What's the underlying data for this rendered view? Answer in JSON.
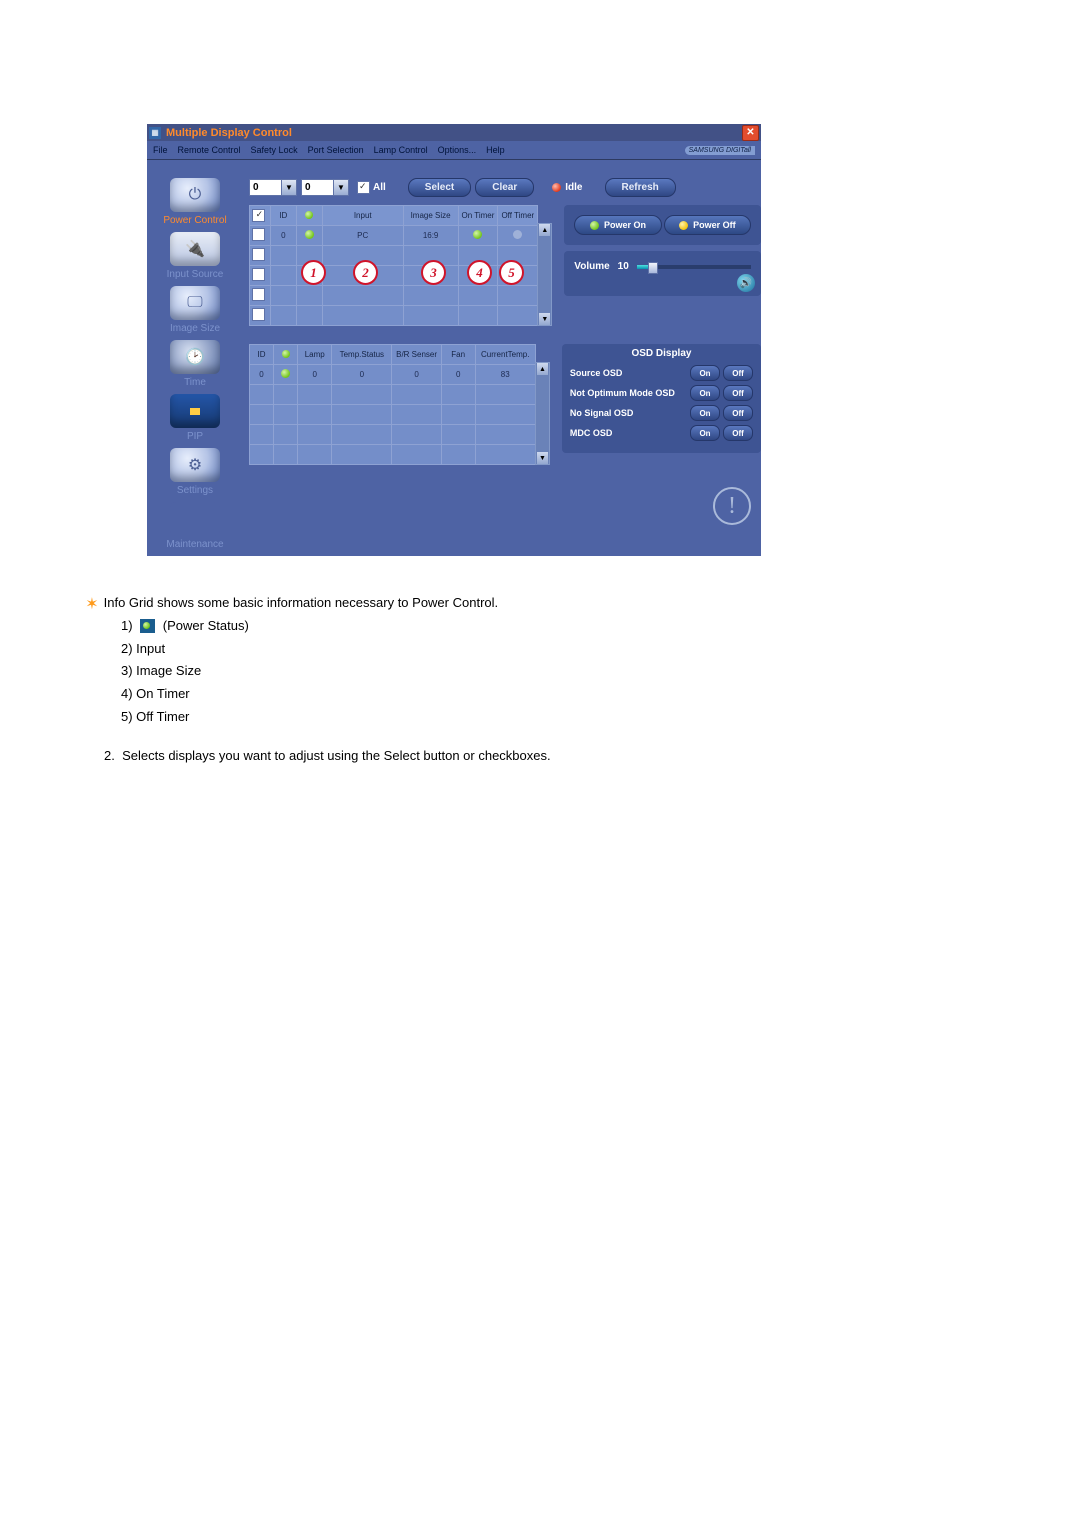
{
  "window": {
    "title": "Multiple Display Control",
    "brand": "SAMSUNG DIGITall"
  },
  "menu": {
    "items": [
      "File",
      "Remote Control",
      "Safety Lock",
      "Port Selection",
      "Lamp Control",
      "Options...",
      "Help"
    ]
  },
  "sidebar": {
    "items": [
      {
        "label": "Power Control",
        "active": true
      },
      {
        "label": "Input Source"
      },
      {
        "label": "Image Size"
      },
      {
        "label": "Time"
      },
      {
        "label": "PIP"
      },
      {
        "label": "Settings"
      },
      {
        "label": "Maintenance"
      }
    ]
  },
  "toolbar": {
    "spin1": "0",
    "spin2": "0",
    "all_checked": true,
    "all_label": "All",
    "select_label": "Select",
    "clear_label": "Clear",
    "idle_label": "Idle",
    "refresh_label": "Refresh"
  },
  "grid_top": {
    "headers": [
      "",
      "ID",
      "",
      "Input",
      "Image Size",
      "On Timer",
      "Off Timer"
    ],
    "row": {
      "checked": false,
      "id": "0",
      "power": "green",
      "input": "PC",
      "size": "16:9",
      "on": "green",
      "off": "grey"
    },
    "blank_rows": 4
  },
  "annotations": [
    "1",
    "2",
    "3",
    "4",
    "5"
  ],
  "power": {
    "on": "Power On",
    "off": "Power Off"
  },
  "volume": {
    "label": "Volume",
    "value": "10"
  },
  "grid_bottom": {
    "headers": [
      "ID",
      "",
      "Lamp",
      "Temp.Status",
      "B/R Senser",
      "Fan",
      "CurrentTemp."
    ],
    "row": {
      "id": "0",
      "pw": "green",
      "lamp": "0",
      "ts": "0",
      "brs": "0",
      "fan": "0",
      "ct": "83"
    },
    "blank_rows": 4
  },
  "osd": {
    "title": "OSD Display",
    "rows": [
      {
        "label": "Source OSD"
      },
      {
        "label": "Not Optimum Mode OSD"
      },
      {
        "label": "No Signal OSD"
      },
      {
        "label": "MDC OSD"
      }
    ],
    "on": "On",
    "off": "Off"
  },
  "docs": {
    "intro": "Info Grid shows some basic information necessary to Power Control.",
    "list": [
      "(Power Status)",
      "Input",
      "Image Size",
      "On Timer",
      "Off Timer"
    ],
    "second": "Selects displays you want to adjust using the Select button or checkboxes."
  }
}
